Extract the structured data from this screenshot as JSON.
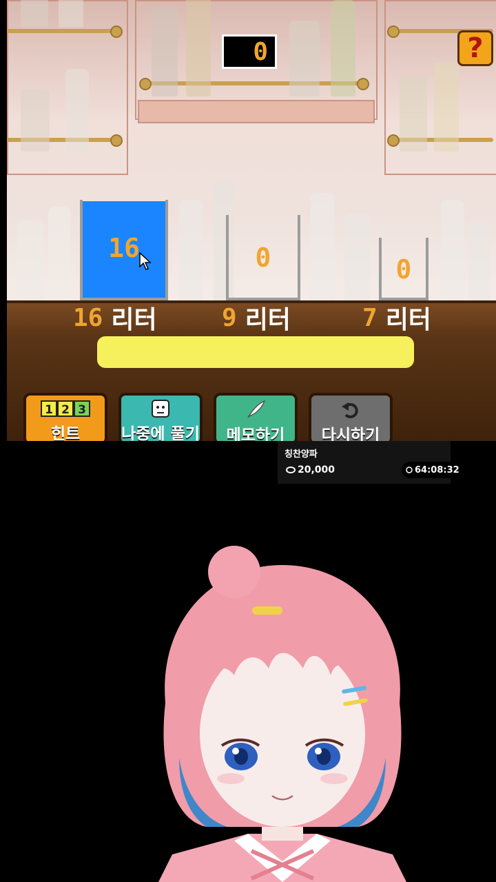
{
  "game": {
    "score": "0",
    "help_label": "?",
    "jugs": [
      {
        "value": "16",
        "fill_fraction": 1.0,
        "capacity": "16",
        "unit": "리터"
      },
      {
        "value": "0",
        "fill_fraction": 0.0,
        "capacity": "9",
        "unit": "리터"
      },
      {
        "value": "0",
        "fill_fraction": 0.0,
        "capacity": "7",
        "unit": "리터"
      }
    ],
    "message": "",
    "buttons": [
      {
        "label": "힌트",
        "icon_text": "123",
        "color": "#f29a1a"
      },
      {
        "label": "나중에 풀기",
        "icon": "face-icon",
        "color": "#3bb8b0"
      },
      {
        "label": "메모하기",
        "icon": "feather-icon",
        "color": "#41b58a"
      },
      {
        "label": "다시하기",
        "icon": "undo-icon",
        "color": "#6e6e6e"
      }
    ]
  },
  "stream_overlay": {
    "title": "칭찬양파",
    "amount": "20,000",
    "timer": "64:08:32"
  },
  "colors": {
    "water": "#1a85ff",
    "digits": "#f0a531",
    "message_bar": "#f6f05c"
  }
}
